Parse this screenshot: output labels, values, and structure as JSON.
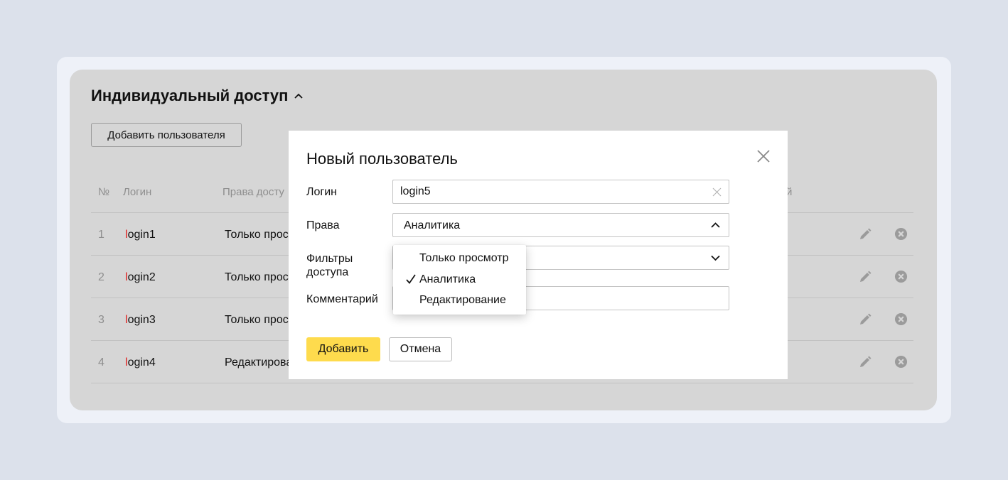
{
  "section": {
    "title": "Индивидуальный доступ",
    "add_user_label": "Добавить пользователя"
  },
  "table": {
    "headers": {
      "num": "№",
      "login": "Логин",
      "rights": "Права досту",
      "comment_tail": "й"
    },
    "rows": [
      {
        "num": "1",
        "login_first": "l",
        "login_rest": "ogin1",
        "rights": "Только прос"
      },
      {
        "num": "2",
        "login_first": "l",
        "login_rest": "ogin2",
        "rights": "Только прос"
      },
      {
        "num": "3",
        "login_first": "l",
        "login_rest": "ogin3",
        "rights": "Только прос"
      },
      {
        "num": "4",
        "login_first": "l",
        "login_rest": "ogin4",
        "rights": "Редактирова"
      }
    ]
  },
  "modal": {
    "title": "Новый пользователь",
    "login_label": "Логин",
    "login_value": "login5",
    "rights_label": "Права",
    "rights_value": "Аналитика",
    "filters_label_line1": "Фильтры",
    "filters_label_line2": "доступа",
    "comment_label": "Комментарий",
    "add_label": "Добавить",
    "cancel_label": "Отмена"
  },
  "rights_dropdown": {
    "options": [
      "Только просмотр",
      "Аналитика",
      "Редактирование"
    ],
    "selected": "Аналитика"
  },
  "icons": {
    "title_toggle": "chevron-up-icon",
    "modal_close": "close-icon",
    "input_clear": "clear-icon",
    "select_open": "chevron-up-icon",
    "select_closed": "chevron-down-icon",
    "option_selected": "checkmark-icon",
    "row_edit": "pencil-icon",
    "row_remove": "remove-circle-icon"
  },
  "colors": {
    "page_bg": "#dce1eb",
    "panel_bg": "#d6d6d6",
    "primary_button": "#fedb4d",
    "login_accent": "#e0201e"
  }
}
